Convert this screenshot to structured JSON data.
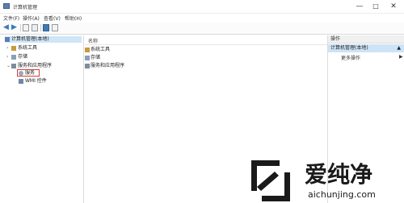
{
  "window": {
    "title": "计算机管理",
    "controls": {
      "minimize": "—",
      "maximize": "□",
      "close": "✕"
    }
  },
  "menu": [
    "文件(F)",
    "操作(A)",
    "查看(V)",
    "帮助(H)"
  ],
  "tree": {
    "root": "计算机管理(本地)",
    "items": [
      {
        "label": "系统工具",
        "expander": "›"
      },
      {
        "label": "存储",
        "expander": "›"
      },
      {
        "label": "服务和应用程序",
        "expander": "⌄"
      },
      {
        "label": "服务"
      },
      {
        "label": "WMI 控件"
      }
    ]
  },
  "center": {
    "column_header": "名称",
    "items": [
      "系统工具",
      "存储",
      "服务和应用程序"
    ]
  },
  "actions": {
    "header": "操作",
    "selected": "计算机管理(本地)",
    "more": "更多操作",
    "tri_up": "▲",
    "tri_right": "▶"
  },
  "watermark": {
    "brand": "爱纯净",
    "url": "aichunjing.com"
  },
  "colors": {
    "selection": "#cfe5f8",
    "highlight_box": "#d23c3c",
    "accent": "#3d7ab8"
  }
}
